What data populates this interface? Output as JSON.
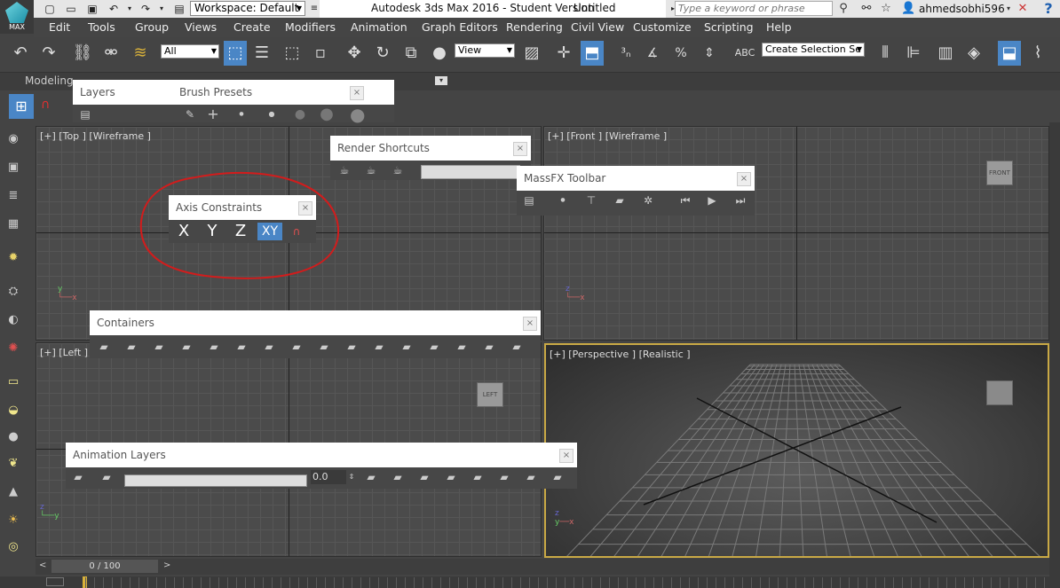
{
  "titlebar": {
    "logo_label": "MAX",
    "workspace": "Workspace: Default",
    "app_title": "Autodesk 3ds Max 2016 - Student Version",
    "doc_title": "Untitled",
    "search_placeholder": "Type a keyword or phrase",
    "user": "ahmedsobhi596"
  },
  "menu": [
    "Edit",
    "Tools",
    "Group",
    "Views",
    "Create",
    "Modifiers",
    "Animation",
    "Graph Editors",
    "Rendering",
    "Civil View",
    "Customize",
    "Scripting",
    "Help"
  ],
  "toolbar": {
    "filter": "All",
    "refcoord": "View",
    "selection_set_placeholder": "Create Selection Se"
  },
  "ribbon": {
    "tab_modeling": "Modeling"
  },
  "viewports": {
    "top": "[+] [Top ] [Wireframe ]",
    "front": "[+] [Front ] [Wireframe ]",
    "left": "[+] [Left ]",
    "perspective": "[+] [Perspective ] [Realistic ]",
    "cube_front": "FRONT",
    "cube_left": "LEFT"
  },
  "floating": {
    "layers": "Layers",
    "brush_presets": "Brush Presets",
    "render_shortcuts": "Render Shortcuts",
    "massfx": "MassFX Toolbar",
    "axis_constraints": "Axis Constraints",
    "axis_x": "X",
    "axis_y": "Y",
    "axis_z": "Z",
    "axis_xy": "XY",
    "containers": "Containers",
    "animation_layers": "Animation Layers",
    "anim_weight": "0.0"
  },
  "timeline": {
    "counter": "0 / 100"
  },
  "colors": {
    "annotation_red": "#d21c1c",
    "accent_blue": "#4a86c6",
    "persp_border": "#c9a945"
  }
}
